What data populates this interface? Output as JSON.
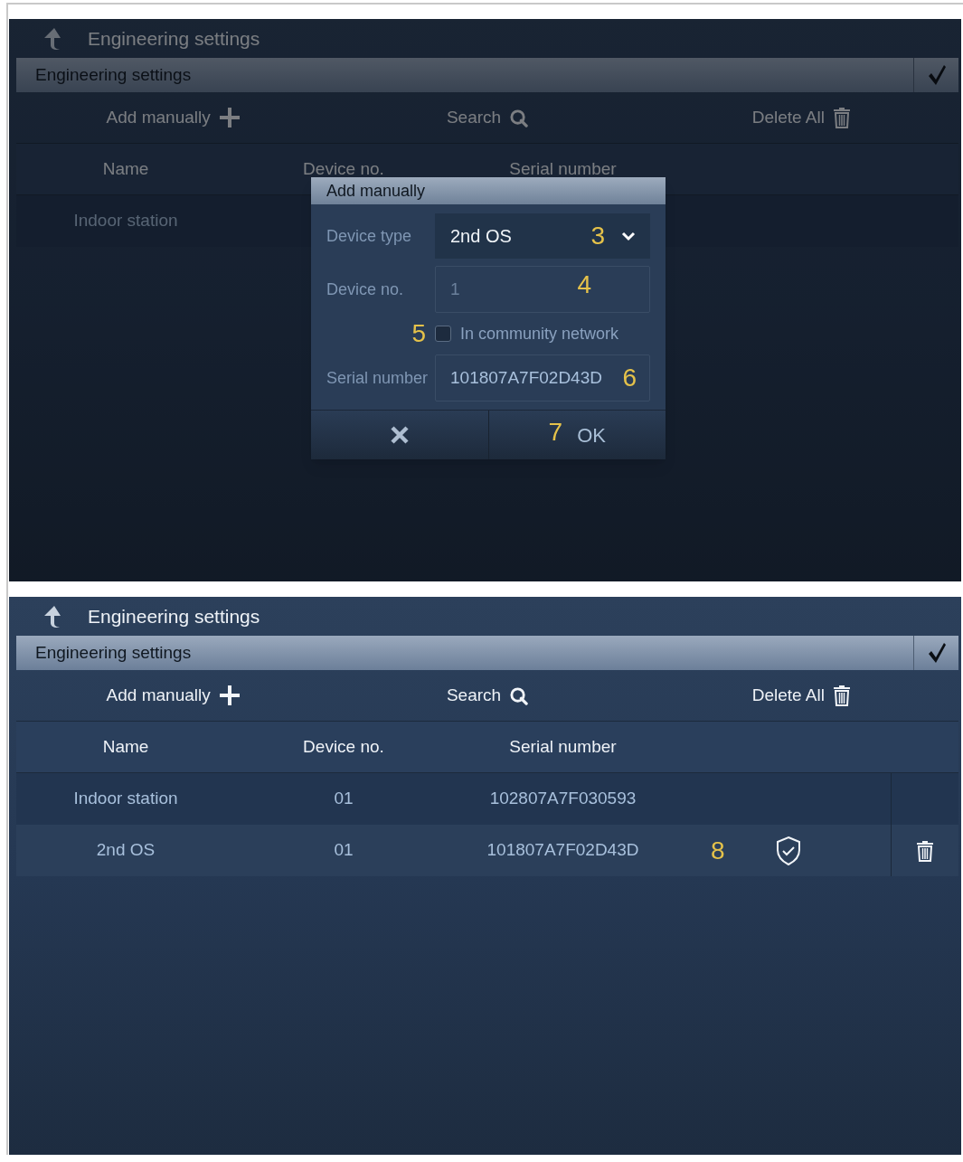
{
  "top_screen": {
    "title": "Engineering settings",
    "subtitle": "Engineering settings",
    "toolbar": [
      {
        "kind": "add",
        "label": "Add manually"
      },
      {
        "kind": "search",
        "label": "Search"
      },
      {
        "kind": "delete",
        "label": "Delete All"
      }
    ],
    "columns": [
      "Name",
      "Device no.",
      "Serial number"
    ],
    "rows": [
      {
        "name": "Indoor station"
      }
    ],
    "dialog": {
      "title": "Add manually",
      "fields": [
        {
          "kind": "dropdown",
          "label": "Device type",
          "value": "2nd OS",
          "callout": "3"
        },
        {
          "kind": "input",
          "label": "Device no.",
          "placeholder": "1",
          "callout": "4"
        },
        {
          "kind": "checkbox",
          "label": "In community network",
          "checked": false,
          "callout": "5"
        },
        {
          "kind": "input",
          "label": "Serial number",
          "value": "101807A7F02D43D",
          "callout": "6"
        }
      ],
      "buttons": [
        {
          "kind": "cancel"
        },
        {
          "kind": "ok",
          "label": "OK",
          "callout": "7"
        }
      ]
    }
  },
  "bottom_screen": {
    "title": "Engineering settings",
    "subtitle": "Engineering settings",
    "toolbar": [
      {
        "kind": "add",
        "label": "Add manually"
      },
      {
        "kind": "search",
        "label": "Search"
      },
      {
        "kind": "delete",
        "label": "Delete All"
      }
    ],
    "columns": [
      "Name",
      "Device no.",
      "Serial number"
    ],
    "rows": [
      {
        "name": "Indoor station",
        "device_no": "01",
        "serial": "102807A7F030593",
        "verified": false,
        "deletable": false
      },
      {
        "name": "2nd OS",
        "device_no": "01",
        "serial": "101807A7F02D43D",
        "callout": "8",
        "verified": true,
        "deletable": true
      }
    ]
  }
}
